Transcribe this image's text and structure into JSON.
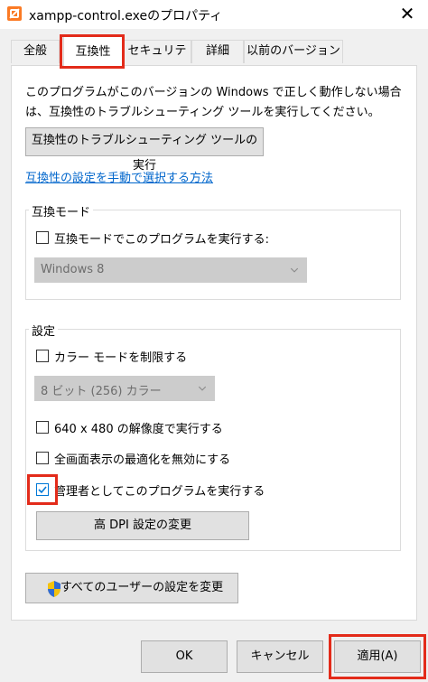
{
  "window": {
    "title": "xampp-control.exeのプロパティ",
    "close_glyph": "✕",
    "app_icon": "xampp-icon"
  },
  "tabs": [
    {
      "label": "全般"
    },
    {
      "label": "互換性"
    },
    {
      "label": "セキュリティ"
    },
    {
      "label": "詳細"
    },
    {
      "label": "以前のバージョン"
    }
  ],
  "compat": {
    "description": "このプログラムがこのバージョンの Windows で正しく動作しない場合は、互換性のトラブルシューティング ツールを実行してください。",
    "troubleshoot_button": "互換性のトラブルシューティング ツールの実行",
    "manual_link": "互換性の設定を手動で選択する方法",
    "mode_group": {
      "title": "互換モード",
      "checkbox_label": "互換モードでこのプログラムを実行する:",
      "checked": false,
      "os_value": "Windows 8"
    },
    "settings_group": {
      "title": "設定",
      "reduced_color_label": "カラー モードを制限する",
      "reduced_color_checked": false,
      "color_value": "8 ビット (256) カラー",
      "res640_label": "640 x 480 の解像度で実行する",
      "res640_checked": false,
      "fullscreen_opt_label": "全画面表示の最適化を無効にする",
      "fullscreen_opt_checked": false,
      "admin_label": "管理者としてこのプログラムを実行する",
      "admin_checked": true,
      "dpi_button": "高 DPI 設定の変更"
    },
    "all_users_button": "すべてのユーザーの設定を変更",
    "all_users_icon": "uac-shield-icon"
  },
  "footer": {
    "ok": "OK",
    "cancel": "キャンセル",
    "apply": "適用(A)"
  },
  "colors": {
    "highlight_red": "#e32b1a",
    "link_blue": "#0066cc",
    "focus_blue": "#0078d7",
    "dialog_bg": "#f0f0f0"
  }
}
